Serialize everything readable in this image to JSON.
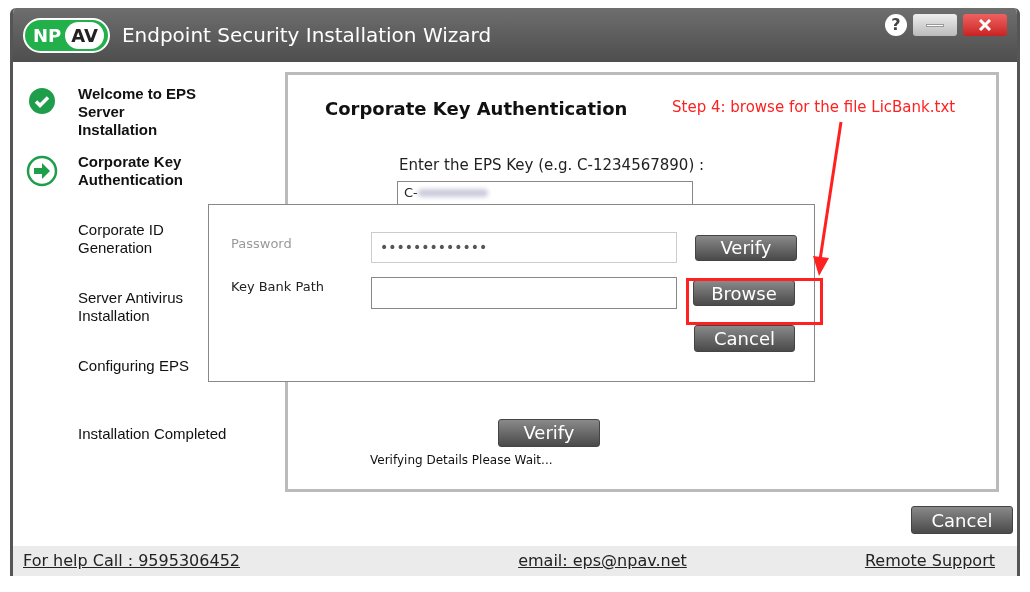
{
  "window": {
    "logo_left": "NP",
    "logo_right": "AV",
    "title": "Endpoint Security Installation Wizard",
    "help": "?"
  },
  "steps": [
    {
      "label": "Welcome to EPS Server Installation",
      "done": true,
      "current": false
    },
    {
      "label": "Corporate Key Authentication",
      "done": false,
      "current": true
    },
    {
      "label": "Corporate ID Generation",
      "done": false,
      "current": false
    },
    {
      "label": "Server Antivirus Installation",
      "done": false,
      "current": false
    },
    {
      "label": "Configuring EPS",
      "done": false,
      "current": false
    },
    {
      "label": "Installation Completed",
      "done": false,
      "current": false
    }
  ],
  "panel": {
    "title": "Corporate Key Authentication",
    "key_label": "Enter the EPS Key (e.g. C-1234567890) :",
    "key_value": "C-",
    "verify": "Verify",
    "status": "Verifying Details Please Wait..."
  },
  "dialog": {
    "password_label": "Password",
    "password_value": "•••••••••••••",
    "verify": "Verify",
    "path_label": "Key Bank Path",
    "browse": "Browse",
    "cancel": "Cancel"
  },
  "annotation": "Step 4: browse for the file LicBank.txt",
  "cancel": "Cancel",
  "footer": {
    "help": "For help Call : 9595306452",
    "email": "email: eps@npav.net",
    "remote": "Remote Support"
  }
}
